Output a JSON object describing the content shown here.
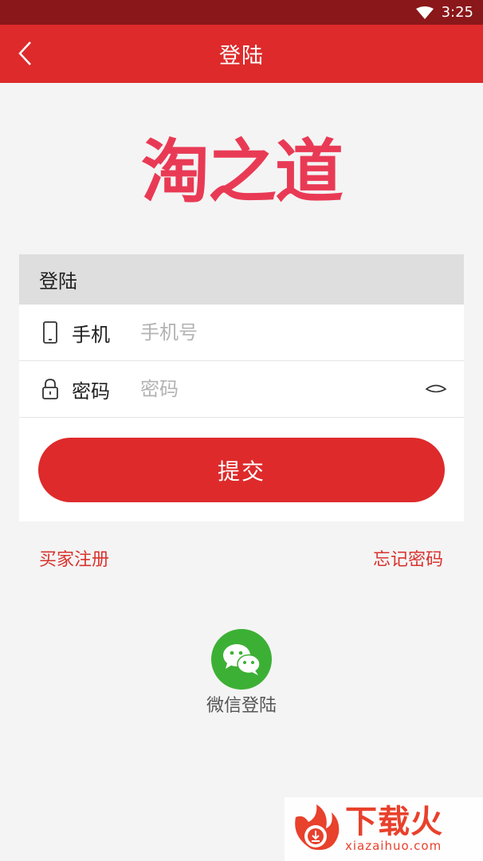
{
  "status_bar": {
    "time": "3:25"
  },
  "nav": {
    "title": "登陆",
    "back_icon": "chevron-left-icon"
  },
  "logo": {
    "text": "淘之道"
  },
  "form": {
    "header": "登陆",
    "phone": {
      "label": "手机",
      "placeholder": "手机号",
      "value": "",
      "icon": "phone-icon"
    },
    "password": {
      "label": "密码",
      "placeholder": "密码",
      "value": "",
      "icon": "lock-icon",
      "toggle_icon": "eye-icon"
    },
    "submit_label": "提交"
  },
  "links": {
    "register": "买家注册",
    "forgot": "忘记密码"
  },
  "wechat": {
    "label": "微信登陆",
    "icon": "wechat-icon"
  },
  "watermark": {
    "name": "下载火",
    "domain": "xiazaihuo.com"
  },
  "colors": {
    "status_bar": "#8a171a",
    "primary": "#de2a2b",
    "logo": "#e93a55",
    "link": "#d9332f",
    "wechat": "#3cb034",
    "background": "#f4f4f4"
  }
}
